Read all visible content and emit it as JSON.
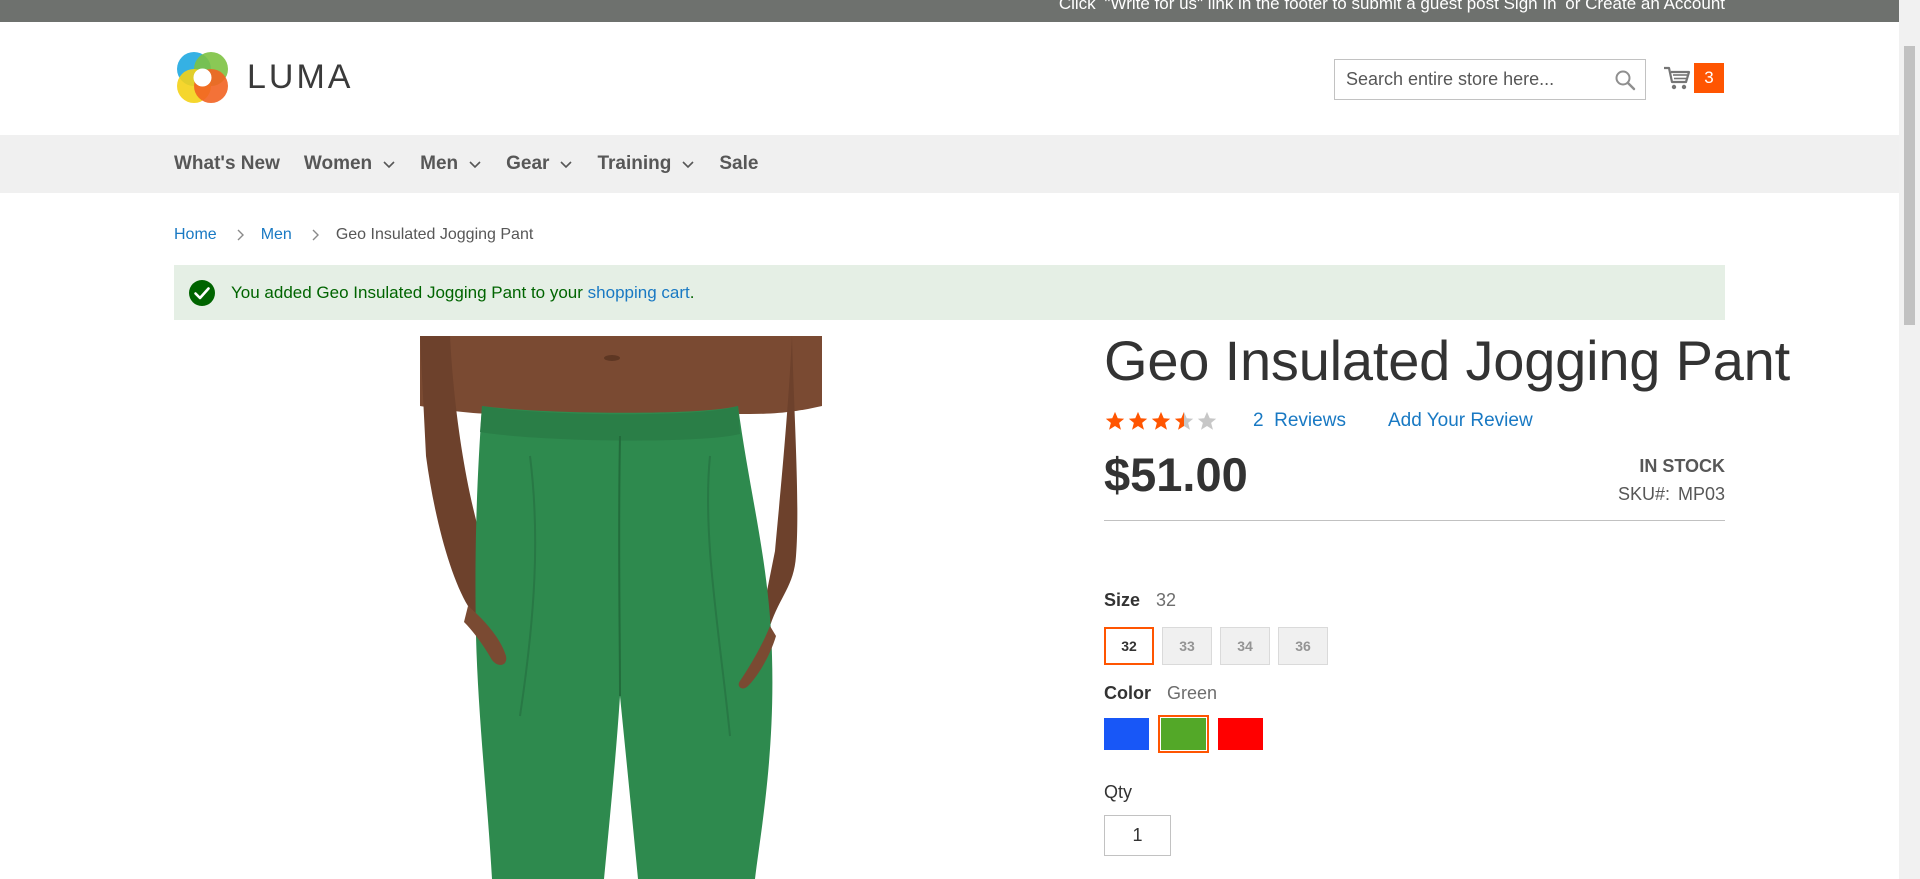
{
  "top_panel": {
    "notice_prefix": "Click",
    "notice_text": "\"Write for us\" link in the footer to submit a guest post",
    "sign_in": "Sign In",
    "or": "or",
    "create_account": "Create an Account"
  },
  "header": {
    "logo_text": "LUMA",
    "search_placeholder": "Search entire store here...",
    "cart_count": "3"
  },
  "nav": {
    "items": [
      {
        "label": "What's New",
        "has_dropdown": false
      },
      {
        "label": "Women",
        "has_dropdown": true
      },
      {
        "label": "Men",
        "has_dropdown": true
      },
      {
        "label": "Gear",
        "has_dropdown": true
      },
      {
        "label": "Training",
        "has_dropdown": true
      },
      {
        "label": "Sale",
        "has_dropdown": false
      }
    ]
  },
  "breadcrumbs": {
    "home": "Home",
    "men": "Men",
    "current": "Geo Insulated Jogging Pant"
  },
  "message": {
    "text": "You added Geo Insulated Jogging Pant to your ",
    "link": "shopping cart",
    "suffix": "."
  },
  "product": {
    "title": "Geo Insulated Jogging Pant",
    "rating_stars": 3.5,
    "rating_max": 5,
    "reviews_count": "2",
    "reviews_label": "Reviews",
    "add_review": "Add Your Review",
    "price": "$51.00",
    "stock": "IN STOCK",
    "sku_label": "SKU#:",
    "sku": "MP03",
    "image_color": "#2e8a4e"
  },
  "options": {
    "size_label": "Size",
    "size_selected": "32",
    "sizes": [
      "32",
      "33",
      "34",
      "36"
    ],
    "color_label": "Color",
    "color_selected": "Green",
    "colors": [
      {
        "name": "Blue",
        "hex": "#1857f7"
      },
      {
        "name": "Green",
        "hex": "#53a828"
      },
      {
        "name": "Red",
        "hex": "#ff0000"
      }
    ],
    "qty_label": "Qty",
    "qty_value": "1"
  },
  "colors": {
    "accent": "#ff5501",
    "link": "#1979c3",
    "success_bg": "#e5efe5",
    "success_text": "#006400"
  }
}
